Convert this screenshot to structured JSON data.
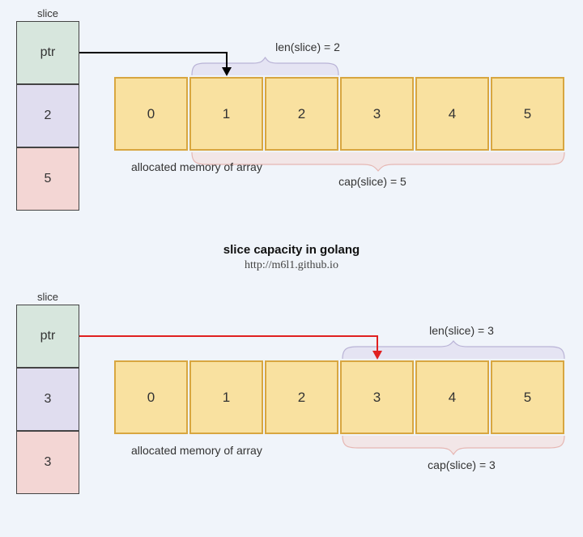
{
  "title": "slice capacity in golang",
  "subtitle": "http://m6l1.github.io",
  "common": {
    "slice_header_label": "slice",
    "ptr_label": "ptr",
    "memory_label": "allocated memory of array",
    "array_cells": [
      "0",
      "1",
      "2",
      "3",
      "4",
      "5"
    ]
  },
  "diagram1": {
    "len_value": "2",
    "cap_value": "5",
    "len_text": "len(slice) = 2",
    "cap_text": "cap(slice) = 5",
    "ptr_target_index": 1
  },
  "diagram2": {
    "len_value": "3",
    "cap_value": "3",
    "len_text": "len(slice) = 3",
    "cap_text": "cap(slice) = 3",
    "ptr_target_index": 3
  },
  "colors": {
    "arrow_black": "#000000",
    "arrow_red": "#e02020",
    "brace_len": "#b9b3d6",
    "brace_cap": "#e6b7b3"
  }
}
